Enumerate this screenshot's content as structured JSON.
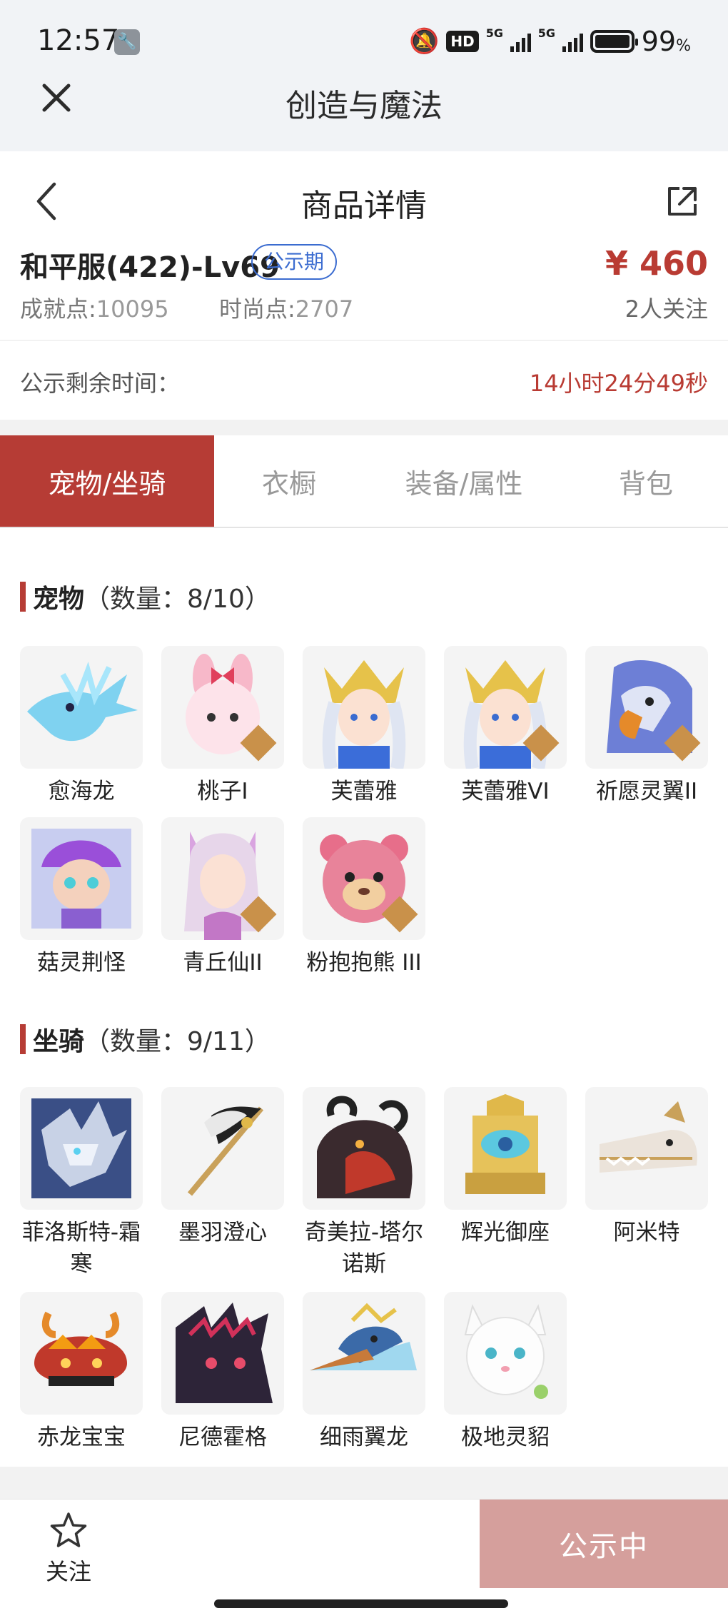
{
  "status_bar": {
    "time": "12:57",
    "net1": "5G",
    "net2": "5G",
    "battery": "99",
    "battery_unit": "%",
    "hd": "HD"
  },
  "webview": {
    "title": "创造与魔法"
  },
  "header": {
    "title": "商品详情"
  },
  "item": {
    "name": "和平服(422)-Lv69",
    "badge": "公示期",
    "price": "¥ 460",
    "achievement_label": "成就点:",
    "achievement_value": "10095",
    "fashion_label": "时尚点:",
    "fashion_value": "2707",
    "followers": "2人关注"
  },
  "countdown": {
    "label": "公示剩余时间：",
    "value": "14小时24分49秒"
  },
  "tabs": [
    {
      "label": "宠物/坐骑",
      "active": true
    },
    {
      "label": "衣橱",
      "active": false
    },
    {
      "label": "装备/属性",
      "active": false
    },
    {
      "label": "背包",
      "active": false
    }
  ],
  "pets": {
    "title": "宠物",
    "count": "（数量：8/10）",
    "items": [
      {
        "name": "愈海龙",
        "icon": "sea-dragon"
      },
      {
        "name": "桃子I",
        "icon": "pink-bunny"
      },
      {
        "name": "芙蕾雅",
        "icon": "valkyrie"
      },
      {
        "name": "芙蕾雅VI",
        "icon": "valkyrie"
      },
      {
        "name": "祈愿灵翼II",
        "icon": "eagle"
      },
      {
        "name": "菇灵荆怪",
        "icon": "mushroom-elf"
      },
      {
        "name": "青丘仙II",
        "icon": "fox-fairy"
      },
      {
        "name": "粉抱抱熊 III",
        "icon": "pink-bear"
      }
    ]
  },
  "mounts": {
    "title": "坐骑",
    "count": "（数量：9/11）",
    "items": [
      {
        "name": "菲洛斯特-霜寒",
        "icon": "frost-dragon"
      },
      {
        "name": "墨羽澄心",
        "icon": "feather-staff"
      },
      {
        "name": "奇美拉-塔尔诺斯",
        "icon": "chimera"
      },
      {
        "name": "辉光御座",
        "icon": "throne"
      },
      {
        "name": "阿米特",
        "icon": "crocodile"
      },
      {
        "name": "赤龙宝宝",
        "icon": "red-dragon"
      },
      {
        "name": "尼德霍格",
        "icon": "dark-dragon"
      },
      {
        "name": "细雨翼龙",
        "icon": "pterodactyl"
      },
      {
        "name": "极地灵貂",
        "icon": "white-mink"
      }
    ]
  },
  "bottom": {
    "follow_label": "关注",
    "action_label": "公示中"
  }
}
